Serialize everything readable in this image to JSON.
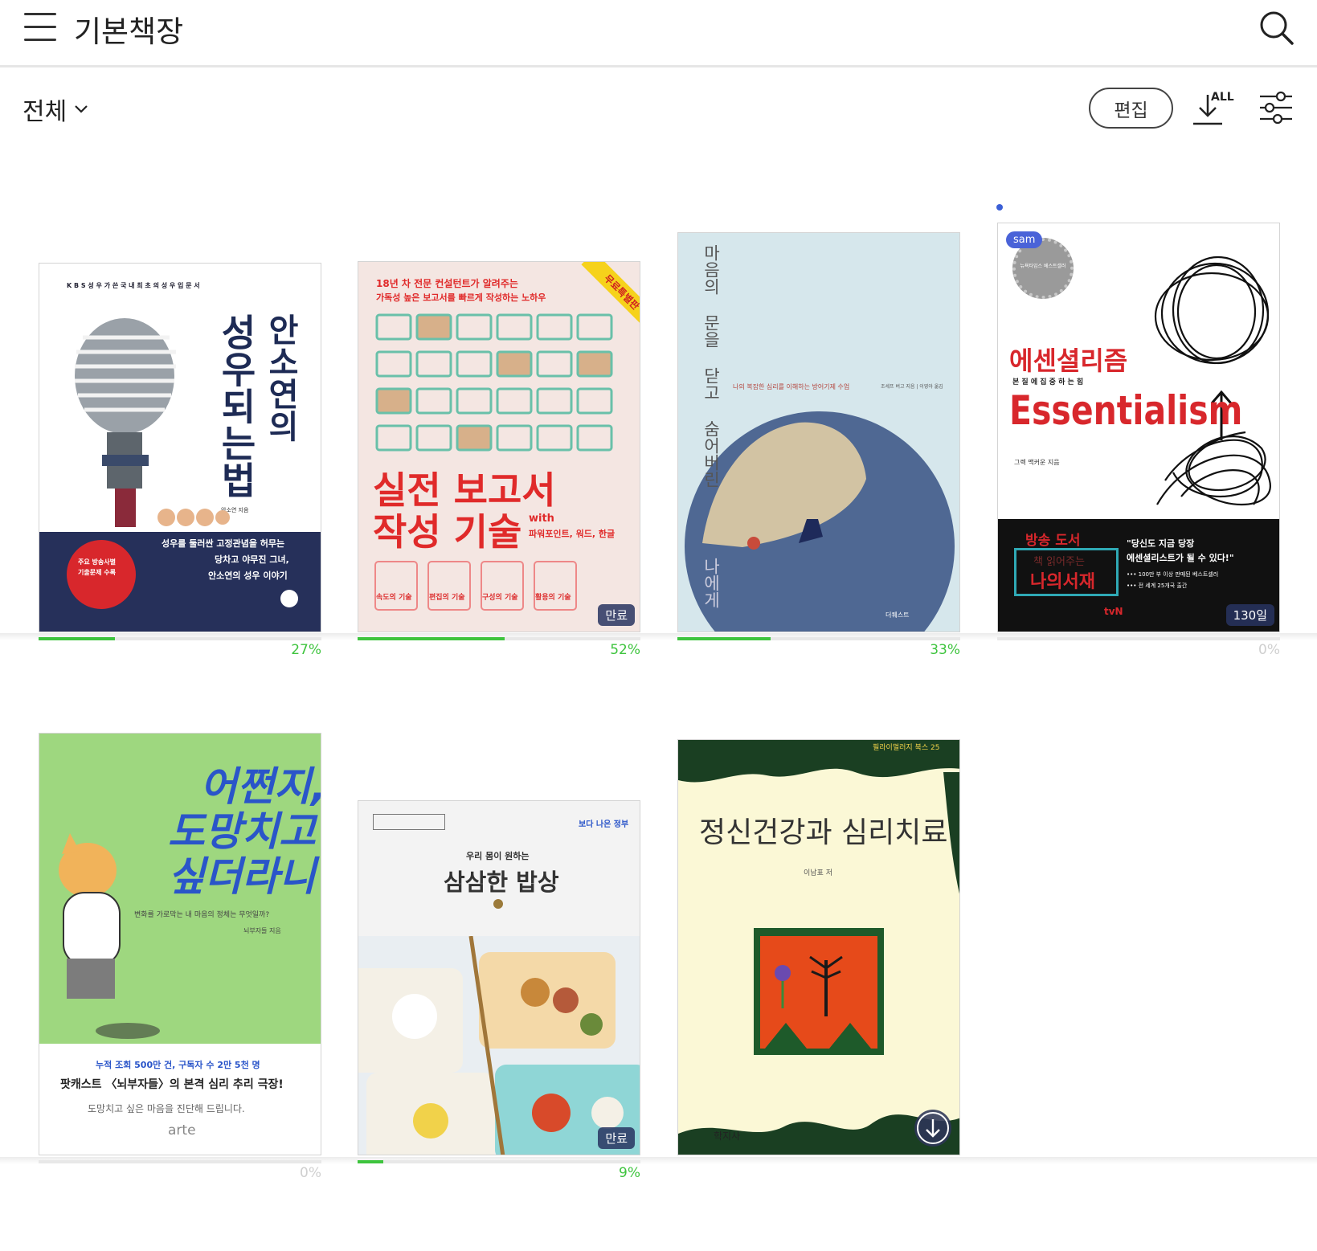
{
  "header": {
    "title": "기본책장",
    "menu_icon": "hamburger-menu-icon",
    "search_icon": "search-icon"
  },
  "toolbar": {
    "filter_label": "전체",
    "edit_label": "편집",
    "download_all_label": "ALL"
  },
  "colors": {
    "progress": "#3ec43e",
    "badge_bg": "#283460",
    "new_dot": "#3b5fd6"
  },
  "books": [
    {
      "progress_label": "27%",
      "progress": 0.27,
      "cover": {
        "top_text": "K B S 성 우 가   쓴   국 내   최 초 의   성 우   입 문 서",
        "author_title": "안소연의",
        "main_title": "성우되는법",
        "author_small": "안소연 지음",
        "band_text_1": "성우를 둘러싼 고정관념을 허무는",
        "band_text_2": "당차고 야무진 그녀,",
        "band_text_3": "안소연의 성우 이야기",
        "circle_text_1": "주요 방송사별",
        "circle_text_2": "기출문제 수록"
      }
    },
    {
      "progress_label": "52%",
      "progress": 0.52,
      "badge": "만료",
      "cover": {
        "sub_1": "18년 차 전문 컨설턴트가 알려주는",
        "sub_2": "가독성 높은 보고서를 빠르게 작성하는 노하우",
        "corner": "무료특별판",
        "title_1": "실전 보고서",
        "title_2": "작성 기술",
        "with": "with",
        "with_sub": "파워포인트, 워드, 한글",
        "chips": [
          "속도의 기술",
          "편집의 기술",
          "구성의 기술",
          "활용의 기술"
        ]
      }
    },
    {
      "progress_label": "33%",
      "progress": 0.33,
      "cover": {
        "title_vertical": "마음의 문을 닫고 숨어버린",
        "title_bottom": "나에게",
        "subtitle": "나의 복잡한 심리를 이해하는 방어기제 수업",
        "author": "조세프 버고 지음 | 이영아 옮김",
        "publisher": "더퀘스트"
      }
    },
    {
      "progress_label": "0%",
      "progress": 0,
      "badge": "130일",
      "new": true,
      "cover": {
        "sam": "sam",
        "seal": "뉴욕타임스 베스트셀러",
        "title_kr": "에센셜리즘",
        "tagline": "본 질 에   집 중 하 는   힘",
        "title_en": "Essentialism",
        "author": "그렉 맥커운 지음",
        "band_left_1": "방송 도서",
        "band_left_2": "책 읽어주는",
        "band_left_3": "나의서재",
        "band_right_1": "\"당신도 지금 당장",
        "band_right_2": "에센셜리스트가 될 수 있다!\"",
        "band_right_3": "••• 100만 부 이상 판매된 베스트셀러",
        "band_right_4": "••• 전 세계 25개국 출간",
        "tvn": "tvN"
      }
    },
    {
      "progress_label": "0%",
      "progress": 0,
      "cover": {
        "title_1": "어쩐지,",
        "title_2": "도망치고",
        "title_3": "싶더라니",
        "subtitle": "변화를 가로막는 내 마음의 정체는 무엇일까?",
        "author": "뇌부자들 지음",
        "line_1": "누적 조회 500만 건, 구독자 수 2만 5천 명",
        "line_2": "팟캐스트 〈뇌부자들〉의 본격 심리 추리 극장!",
        "line_3": "도망치고 싶은 마음을 진단해 드립니다.",
        "publisher": "arte"
      }
    },
    {
      "progress_label": "9%",
      "progress": 0.09,
      "badge": "만료",
      "cover": {
        "pre": "우리 몸이 원하는",
        "title": "삼삼한 밥상",
        "brand": "보다 나은 정부"
      }
    },
    {
      "progress_label": "",
      "progress": 0,
      "download": true,
      "cover": {
        "series": "필라이멀러지 북스 25",
        "title": "정신건강과 심리치료",
        "author": "이남표 저",
        "publisher": "학지사"
      }
    }
  ]
}
